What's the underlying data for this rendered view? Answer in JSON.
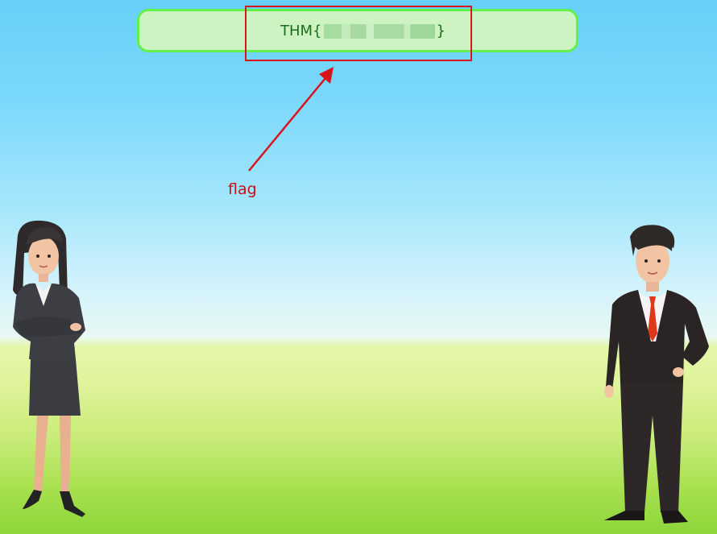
{
  "flag": {
    "prefix": "THM{",
    "suffix": "}",
    "redacted": true
  },
  "annotation": {
    "label": "flag",
    "color": "#d9141c"
  },
  "figures": [
    {
      "name": "businesswoman",
      "pose": "arms-crossed"
    },
    {
      "name": "businessman",
      "pose": "hand-on-hip"
    }
  ],
  "colors": {
    "sky_top": "#67d0f8",
    "grass": "#8cd63b",
    "flag_box_fill": "#ccf3c1",
    "flag_box_border": "#62f04a",
    "flag_text": "#1c6e1a"
  }
}
